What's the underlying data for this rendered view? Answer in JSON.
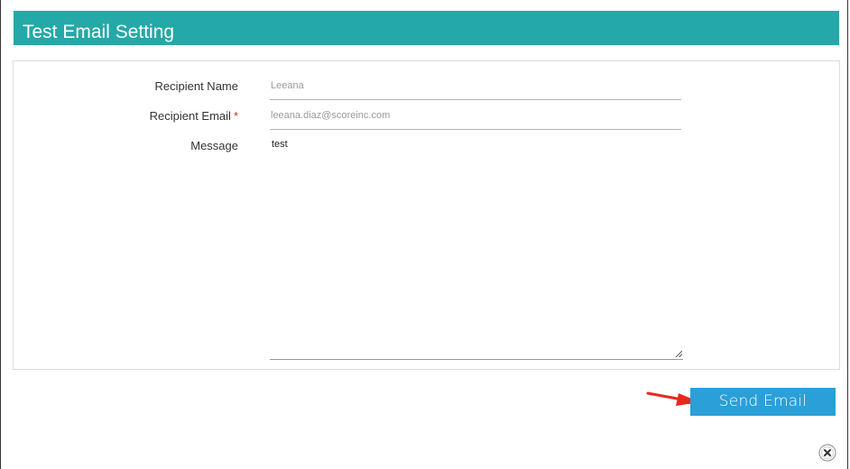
{
  "dialog": {
    "title": "Test Email Setting"
  },
  "form": {
    "recipient_name": {
      "label": "Recipient Name",
      "value": "Leeana"
    },
    "recipient_email": {
      "label": "Recipient Email",
      "required_marker": "*",
      "value": "leeana.diaz@scoreinc.com"
    },
    "message": {
      "label": "Message",
      "value": "test"
    }
  },
  "actions": {
    "send_label": "Send Email"
  },
  "icons": {
    "close": "close-icon",
    "annotation": "red-arrow-icon"
  },
  "colors": {
    "header": "#24a8a8",
    "button": "#2a9fd8",
    "required": "#d9241c",
    "arrow": "#e8281f"
  }
}
